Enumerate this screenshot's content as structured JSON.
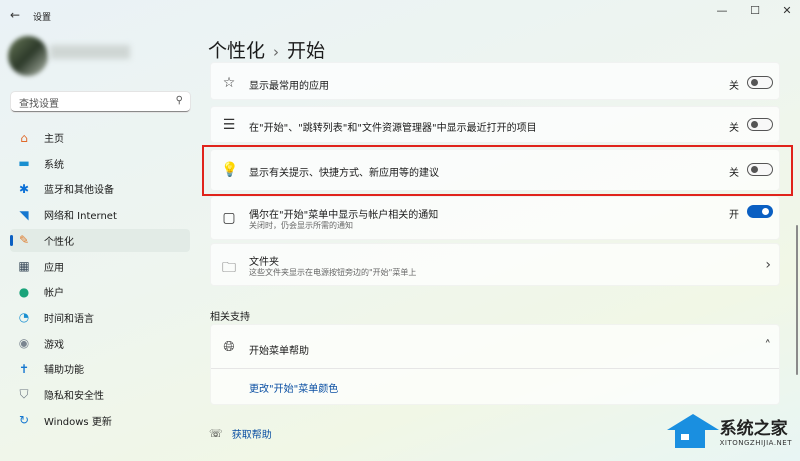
{
  "window": {
    "title": "设置",
    "back": "←",
    "minimize": "—",
    "maximize": "☐",
    "close": "✕"
  },
  "search": {
    "placeholder": "查找设置"
  },
  "sidebar": {
    "items": [
      {
        "label": "主页",
        "icon": "home-icon",
        "glyph": "⌂",
        "color": "#e06a2b"
      },
      {
        "label": "系统",
        "icon": "monitor-icon",
        "glyph": "▬",
        "color": "#1a8fd0"
      },
      {
        "label": "蓝牙和其他设备",
        "icon": "bluetooth-icon",
        "glyph": "✱",
        "color": "#0a6fd6"
      },
      {
        "label": "网络和 Internet",
        "icon": "wifi-icon",
        "glyph": "◥",
        "color": "#1577d0"
      },
      {
        "label": "个性化",
        "icon": "brush-icon",
        "glyph": "✎",
        "color": "#e07a2a",
        "selected": true
      },
      {
        "label": "应用",
        "icon": "apps-icon",
        "glyph": "▦",
        "color": "#3a4a5a"
      },
      {
        "label": "帐户",
        "icon": "account-icon",
        "glyph": "●",
        "color": "#1aa37a"
      },
      {
        "label": "时间和语言",
        "icon": "globe-clock-icon",
        "glyph": "◔",
        "color": "#1a8fd0"
      },
      {
        "label": "游戏",
        "icon": "gamepad-icon",
        "glyph": "◉",
        "color": "#7a8590"
      },
      {
        "label": "辅助功能",
        "icon": "accessibility-icon",
        "glyph": "✝",
        "color": "#1577d0"
      },
      {
        "label": "隐私和安全性",
        "icon": "shield-icon",
        "glyph": "⛉",
        "color": "#6a7580"
      },
      {
        "label": "Windows 更新",
        "icon": "update-icon",
        "glyph": "↻",
        "color": "#1577d0"
      }
    ]
  },
  "breadcrumb": {
    "parent": "个性化",
    "sep": "›",
    "current": "开始"
  },
  "settings": [
    {
      "label": "显示最常用的应用",
      "state": "关",
      "on": false,
      "glyph": "☆"
    },
    {
      "label": "在\"开始\"、\"跳转列表\"和\"文件资源管理器\"中显示最近打开的项目",
      "state": "关",
      "on": false,
      "glyph": "☰"
    },
    {
      "label": "显示有关提示、快捷方式、新应用等的建议",
      "state": "关",
      "on": false,
      "glyph": "💡"
    },
    {
      "label": "偶尔在\"开始\"菜单中显示与帐户相关的通知",
      "sub": "关闭时，仍会显示所需的通知",
      "state": "开",
      "on": true,
      "glyph": "▢"
    },
    {
      "label": "文件夹",
      "sub": "这些文件夹显示在电源按钮旁边的\"开始\"菜单上",
      "glyph": "🗀",
      "chevron": "›"
    }
  ],
  "related": {
    "title": "相关支持",
    "help_title": "开始菜单帮助",
    "chevron": "˄",
    "link": "更改\"开始\"菜单颜色"
  },
  "get_help": "获取帮助",
  "watermark": {
    "name": "系统之家",
    "url": "XITONGZHIJIA.NET"
  },
  "colors": {
    "accent": "#0a5fc2",
    "highlight": "#e0231b"
  }
}
